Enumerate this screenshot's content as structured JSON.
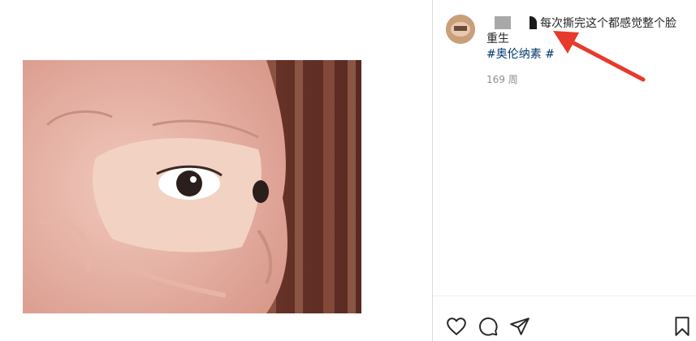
{
  "post": {
    "caption": "每次撕完这个都感觉整个脸重生",
    "hashtags": "#奥伦纳素 #",
    "timestamp": "169 周"
  },
  "icons": {
    "like": "heart-icon",
    "comment": "comment-icon",
    "share": "share-icon",
    "save": "bookmark-icon"
  },
  "colors": {
    "hashtag": "#00376b",
    "annotation_arrow": "#e8392d",
    "text": "#262626",
    "muted": "#8e8e8e"
  }
}
